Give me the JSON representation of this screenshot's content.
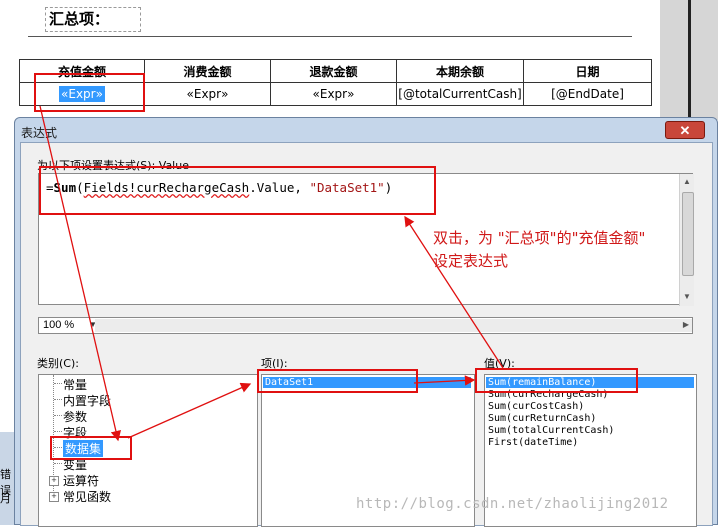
{
  "report": {
    "summary_title": "汇总项：",
    "headers": [
      "充值金额",
      "消费金额",
      "退款金额",
      "本期余额",
      "日期"
    ],
    "cells": [
      "«Expr»",
      "«Expr»",
      "«Expr»",
      "[@totalCurrentCash]",
      "[@EndDate]"
    ]
  },
  "background": {
    "fragment_1": "错误",
    "fragment_2": "月"
  },
  "dialog": {
    "title": "表达式",
    "close_icon": "close-icon",
    "expression_label": "为以下项设置表达式(S): Value",
    "expression": {
      "eq": "=",
      "func": "Sum",
      "open": "(",
      "field": "Fields!curRechargeCash",
      "rest": ".Value, ",
      "str": "\"DataSet1\"",
      "close": ")"
    },
    "zoom": "100 %",
    "category_label": "类别(C):",
    "categories": [
      {
        "label": "常量"
      },
      {
        "label": "内置字段"
      },
      {
        "label": "参数"
      },
      {
        "label": "字段"
      },
      {
        "label": "数据集",
        "selected": true
      },
      {
        "label": "变量"
      },
      {
        "label": "运算符",
        "expandable": true
      },
      {
        "label": "常见函数",
        "expandable": true
      }
    ],
    "item_label": "项(I):",
    "items": [
      {
        "label": "DataSet1",
        "selected": true
      }
    ],
    "value_label": "值(V):",
    "values": [
      {
        "label": "Sum(remainBalance)",
        "selected": true
      },
      {
        "label": "Sum(curRechargeCash)"
      },
      {
        "label": "Sum(curCostCash)"
      },
      {
        "label": "Sum(curReturnCash)"
      },
      {
        "label": "Sum(totalCurrentCash)"
      },
      {
        "label": "First(dateTime)"
      }
    ]
  },
  "annotation": {
    "line1": "双击，为 \"汇总项\"的\"充值金额\"",
    "line2": "设定表达式",
    "color": "#e01010"
  },
  "watermark": "http://blog.csdn.net/zhaolijing2012"
}
